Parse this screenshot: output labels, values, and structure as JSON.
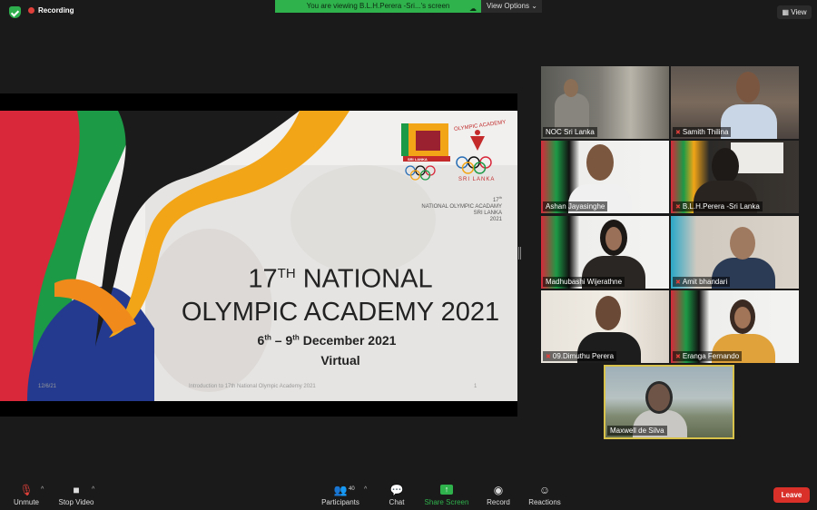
{
  "recording": {
    "label": "Recording"
  },
  "banner": {
    "viewing_text": "You are viewing B.L.H.Perera -Sri...'s screen",
    "view_options": "View Options ⌄"
  },
  "view_button": {
    "label": "View"
  },
  "slide": {
    "title_number": "17",
    "title_sup": "TH",
    "title_rest": " NATIONAL",
    "title_line2": "OLYMPIC ACADEMY 2021",
    "dates_start": "6",
    "dates_start_sup": "th",
    "dates_mid": " – 9",
    "dates_end_sup": "th",
    "dates_rest": " December 2021",
    "virtual": "Virtual",
    "footer_date": "12/6/21",
    "footer_text": "Introduction to 17th National Olympic Academy 2021",
    "footer_page": "1",
    "logo_left_text": "SRI LANKA",
    "logo_right_title": "OLYMPIC ACADEMY",
    "logo_right_sub": "SRI LANKA",
    "nl_line1": "17",
    "nl_line1_sup": "th",
    "nl_line2": "NATIONAL OLYMPIC ACADAMY",
    "nl_line3": "SRI LANKA",
    "nl_line4": "2021"
  },
  "participants": [
    {
      "name": "NOC Sri Lanka",
      "muted": false
    },
    {
      "name": "Samith Thilina",
      "muted": true
    },
    {
      "name": "Ashan Jayasinghe",
      "muted": false
    },
    {
      "name": "B.L.H.Perera -Sri Lanka",
      "muted": true
    },
    {
      "name": "Madhubashi Wijerathne",
      "muted": false
    },
    {
      "name": "Amit bhandari",
      "muted": true
    },
    {
      "name": "09.Dimuthu Perera",
      "muted": true
    },
    {
      "name": "Eranga Fernando",
      "muted": true
    },
    {
      "name": "Maxwell de Silva",
      "muted": false
    }
  ],
  "toolbar": {
    "unmute": "Unmute",
    "stop_video": "Stop Video",
    "participants": "Participants",
    "participants_count": "40",
    "chat": "Chat",
    "share_screen": "Share Screen",
    "record": "Record",
    "reactions": "Reactions",
    "leave": "Leave"
  },
  "colors": {
    "accent_green": "#2fb24c",
    "leave_red": "#d9302a",
    "active_border": "#d8c24a"
  }
}
